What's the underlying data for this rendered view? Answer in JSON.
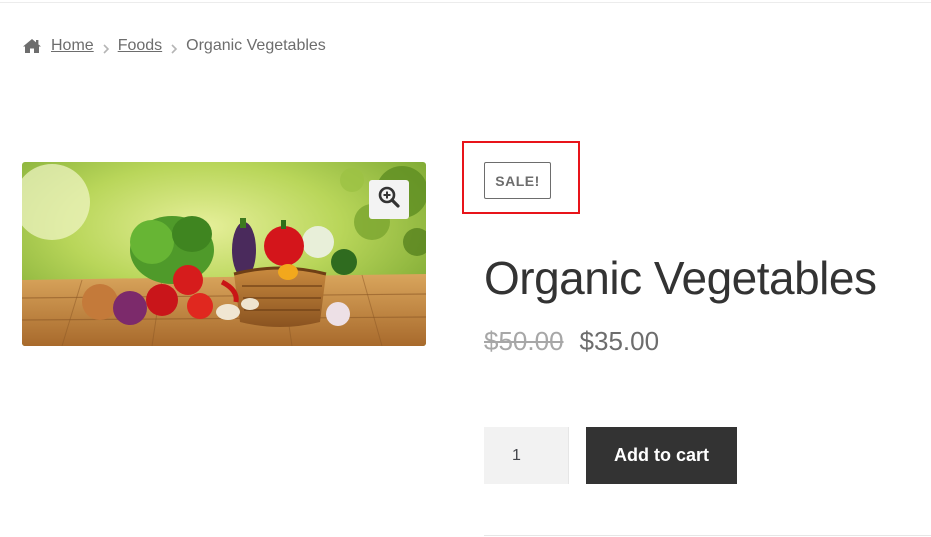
{
  "breadcrumb": {
    "home_icon": "home-icon",
    "items": [
      {
        "label": "Home"
      },
      {
        "label": "Foods"
      }
    ],
    "current": "Organic Vegetables",
    "separator_icon": "chevron-right-icon"
  },
  "product": {
    "badge": "SALE!",
    "title": "Organic Vegetables",
    "price_old": "$50.00",
    "price_new": "$35.00",
    "image_alt": "organic vegetables in a basket",
    "zoom_icon": "zoom-in-icon"
  },
  "cart": {
    "quantity": "1",
    "add_label": "Add to cart"
  },
  "colors": {
    "highlight": "#e8141a",
    "button_bg": "#333333",
    "text": "#6d6d6d"
  }
}
